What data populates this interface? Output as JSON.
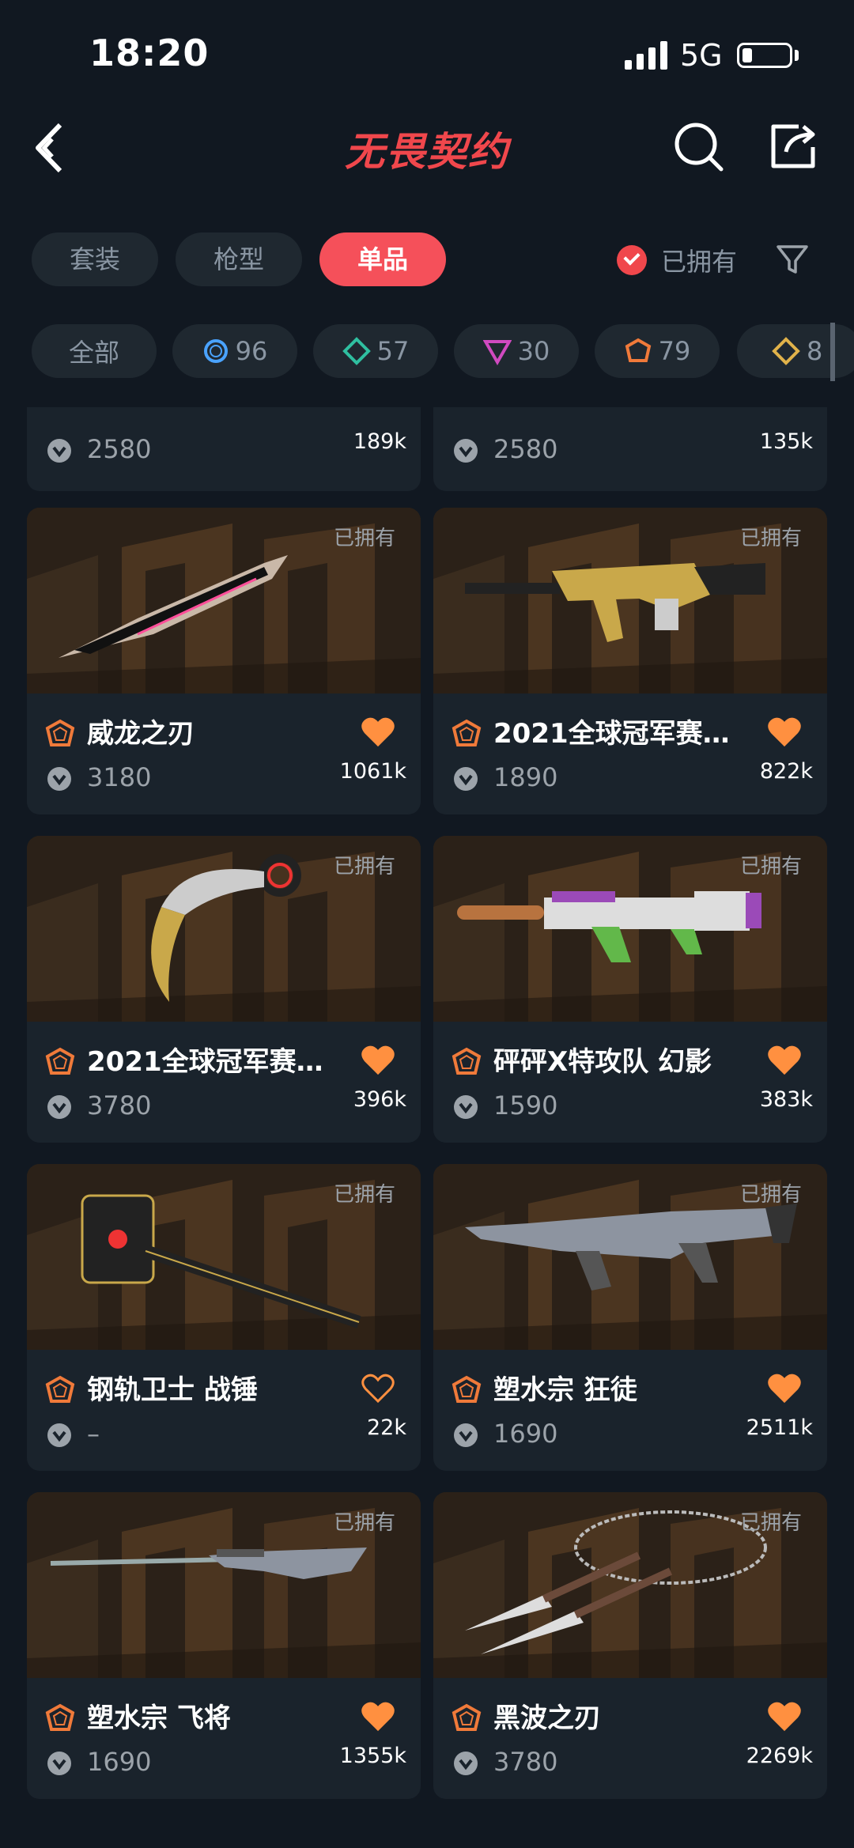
{
  "status_bar": {
    "time": "18:20",
    "network": "5G"
  },
  "header": {
    "logo_text": "无畏契约",
    "back_icon": "chevron-left-icon",
    "search_icon": "search-icon",
    "share_icon": "share-icon"
  },
  "tabs": [
    {
      "label": "套装",
      "active": false
    },
    {
      "label": "枪型",
      "active": false
    },
    {
      "label": "单品",
      "active": true
    }
  ],
  "owned_filter": {
    "label": "已拥有",
    "checked": true
  },
  "chips": [
    {
      "label": "全部",
      "icon": ""
    },
    {
      "label": "96",
      "icon": "ring-icon",
      "color": "#4aa3ff"
    },
    {
      "label": "57",
      "icon": "diamond-icon",
      "color": "#2fbfa0"
    },
    {
      "label": "30",
      "icon": "triangle-icon",
      "color": "#d04ac0"
    },
    {
      "label": "79",
      "icon": "pentagon-icon",
      "color": "#f07a3a"
    },
    {
      "label": "8",
      "icon": "diamond-icon",
      "color": "#e0b24a"
    }
  ],
  "colors": {
    "accent": "#f5505a",
    "heart": "#ff9040",
    "rank": "#f07a3a",
    "background": "#111821",
    "card": "#1a232c"
  },
  "items_partial": [
    {
      "price": "2580",
      "likes": "189k"
    },
    {
      "price": "2580",
      "likes": "135k"
    }
  ],
  "items": [
    {
      "name": "威龙之刃",
      "price": "3180",
      "likes": "1061k",
      "owned_tag": "已拥有",
      "liked": true,
      "weapon": "blade"
    },
    {
      "name": "2021全球冠军赛…",
      "price": "1890",
      "likes": "822k",
      "owned_tag": "已拥有",
      "liked": true,
      "weapon": "rifle-gold"
    },
    {
      "name": "2021全球冠军赛…",
      "price": "3780",
      "likes": "396k",
      "owned_tag": "已拥有",
      "liked": true,
      "weapon": "karambit"
    },
    {
      "name": "砰砰X特攻队 幻影",
      "price": "1590",
      "likes": "383k",
      "owned_tag": "已拥有",
      "liked": true,
      "weapon": "rifle-toy"
    },
    {
      "name": "钢轨卫士 战锤",
      "price": "–",
      "likes": "22k",
      "owned_tag": "已拥有",
      "liked": false,
      "weapon": "hammer"
    },
    {
      "name": "塑水宗 狂徒",
      "price": "1690",
      "likes": "2511k",
      "owned_tag": "已拥有",
      "liked": true,
      "weapon": "rifle-chrome"
    },
    {
      "name": "塑水宗 飞将",
      "price": "1690",
      "likes": "1355k",
      "owned_tag": "已拥有",
      "liked": true,
      "weapon": "sniper"
    },
    {
      "name": "黑波之刃",
      "price": "3780",
      "likes": "2269k",
      "owned_tag": "已拥有",
      "liked": true,
      "weapon": "kunai"
    }
  ]
}
